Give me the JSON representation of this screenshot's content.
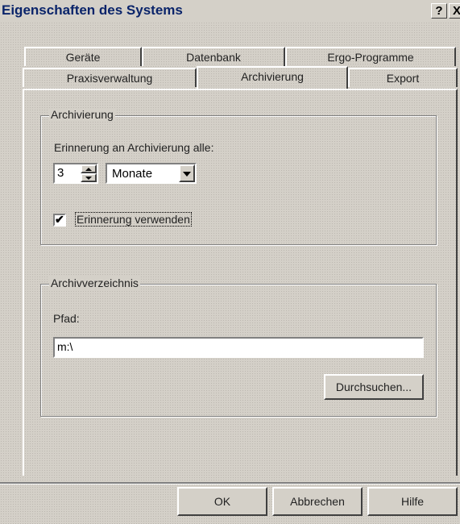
{
  "window": {
    "title": "Eigenschaften des Systems",
    "help_label": "?",
    "close_label": "X"
  },
  "tabs": {
    "row1": [
      {
        "label": "Geräte"
      },
      {
        "label": "Datenbank"
      },
      {
        "label": "Ergo-Programme"
      }
    ],
    "row2": [
      {
        "label": "Praxisverwaltung"
      },
      {
        "label": "Archivierung",
        "active": true
      },
      {
        "label": "Export"
      }
    ]
  },
  "archivierung_group": {
    "legend": "Archivierung",
    "reminder_label": "Erinnerung an Archivierung alle:",
    "interval_value": "3",
    "unit_value": "Monate",
    "use_reminder_label": "Erinnerung verwenden",
    "use_reminder_checked": true
  },
  "archivverzeichnis_group": {
    "legend": "Archivverzeichnis",
    "path_label": "Pfad:",
    "path_value": "m:\\",
    "browse_label": "Durchsuchen..."
  },
  "footer": {
    "ok_label": "OK",
    "cancel_label": "Abbrechen",
    "help_label": "Hilfe"
  },
  "colors": {
    "title_text": "#0a246a",
    "face": "#d4d0c8"
  }
}
